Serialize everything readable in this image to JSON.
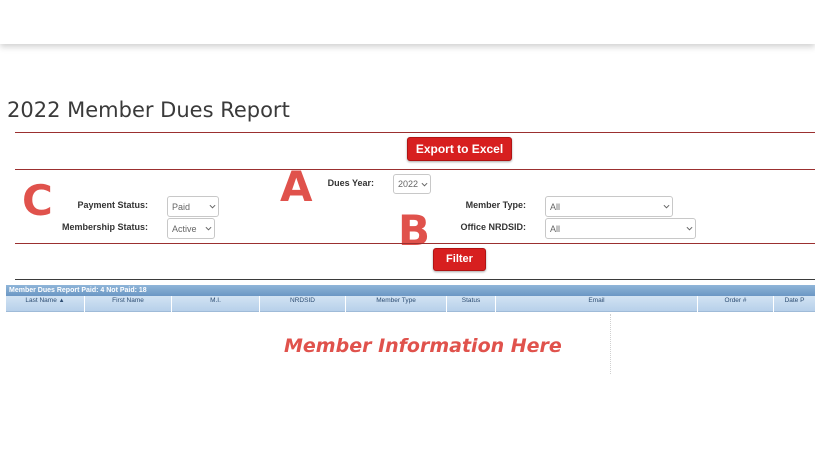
{
  "page": {
    "title": "2022 Member Dues Report"
  },
  "toolbar": {
    "export_label": "Export to Excel",
    "filter_label": "Filter"
  },
  "filters": {
    "dues_year": {
      "label": "Dues Year:",
      "value": "2022"
    },
    "payment_status": {
      "label": "Payment Status:",
      "value": "Paid"
    },
    "membership_status": {
      "label": "Membership Status:",
      "value": "Active"
    },
    "member_type": {
      "label": "Member Type:",
      "value": "All"
    },
    "office_nrdsid": {
      "label": "Office NRDSID:",
      "value": "All"
    }
  },
  "annotations": {
    "a": "A",
    "b": "B",
    "c": "C",
    "placeholder": "Member Information Here"
  },
  "grid": {
    "caption": "Member Dues Report   Paid: 4 Not Paid: 18",
    "columns": [
      "Last Name",
      "First Name",
      "M.I.",
      "NRDSID",
      "Member Type",
      "Status",
      "Email",
      "Order #",
      "Date P"
    ],
    "sort_indicator": "▲"
  },
  "colors": {
    "accent": "#d71f1f",
    "annotation": "#e0524c",
    "divider": "#9b3030",
    "grid_header": "#6b97c4"
  }
}
